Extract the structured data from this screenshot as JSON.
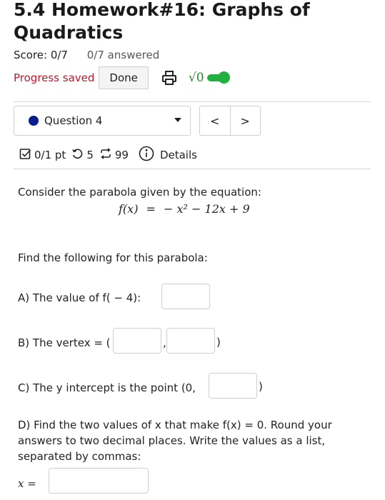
{
  "header": {
    "title": "5.4 Homework#16: Graphs of Quadratics",
    "score": "Score: 0/7",
    "answered": "0/7 answered",
    "progress_saved": "Progress saved",
    "done_label": "Done",
    "sqrt_label": "√0"
  },
  "question_nav": {
    "selected": "Question 4",
    "prev_label": "<",
    "next_label": ">"
  },
  "meta": {
    "points": "0/1 pt",
    "retries": "5",
    "attempts": "99",
    "details": "Details"
  },
  "question": {
    "intro": "Consider the parabola given by the equation:",
    "equation_lhs": "f(x)",
    "equation_eq": "=",
    "equation_rhs": "− x² − 12x + 9",
    "find_prompt": "Find the following for this parabola:",
    "part_a": "A) The value of f( − 4):",
    "part_b": "B) The vertex = (",
    "part_b_comma": ",",
    "part_b_close": ")",
    "part_c": "C) The y intercept is the point (0,",
    "part_c_close": ")",
    "part_d": "D) Find the two values of x that make f(x) = 0. Round your answers to two decimal places. Write the values as a list, separated by commas:",
    "x_label": "x =",
    "answers": {
      "a": "",
      "b_x": "",
      "b_y": "",
      "c": "",
      "d": ""
    }
  },
  "colors": {
    "progress_saved": "#c4162a",
    "toggle": "#22b140",
    "question_dot": "#0b1d8c"
  }
}
